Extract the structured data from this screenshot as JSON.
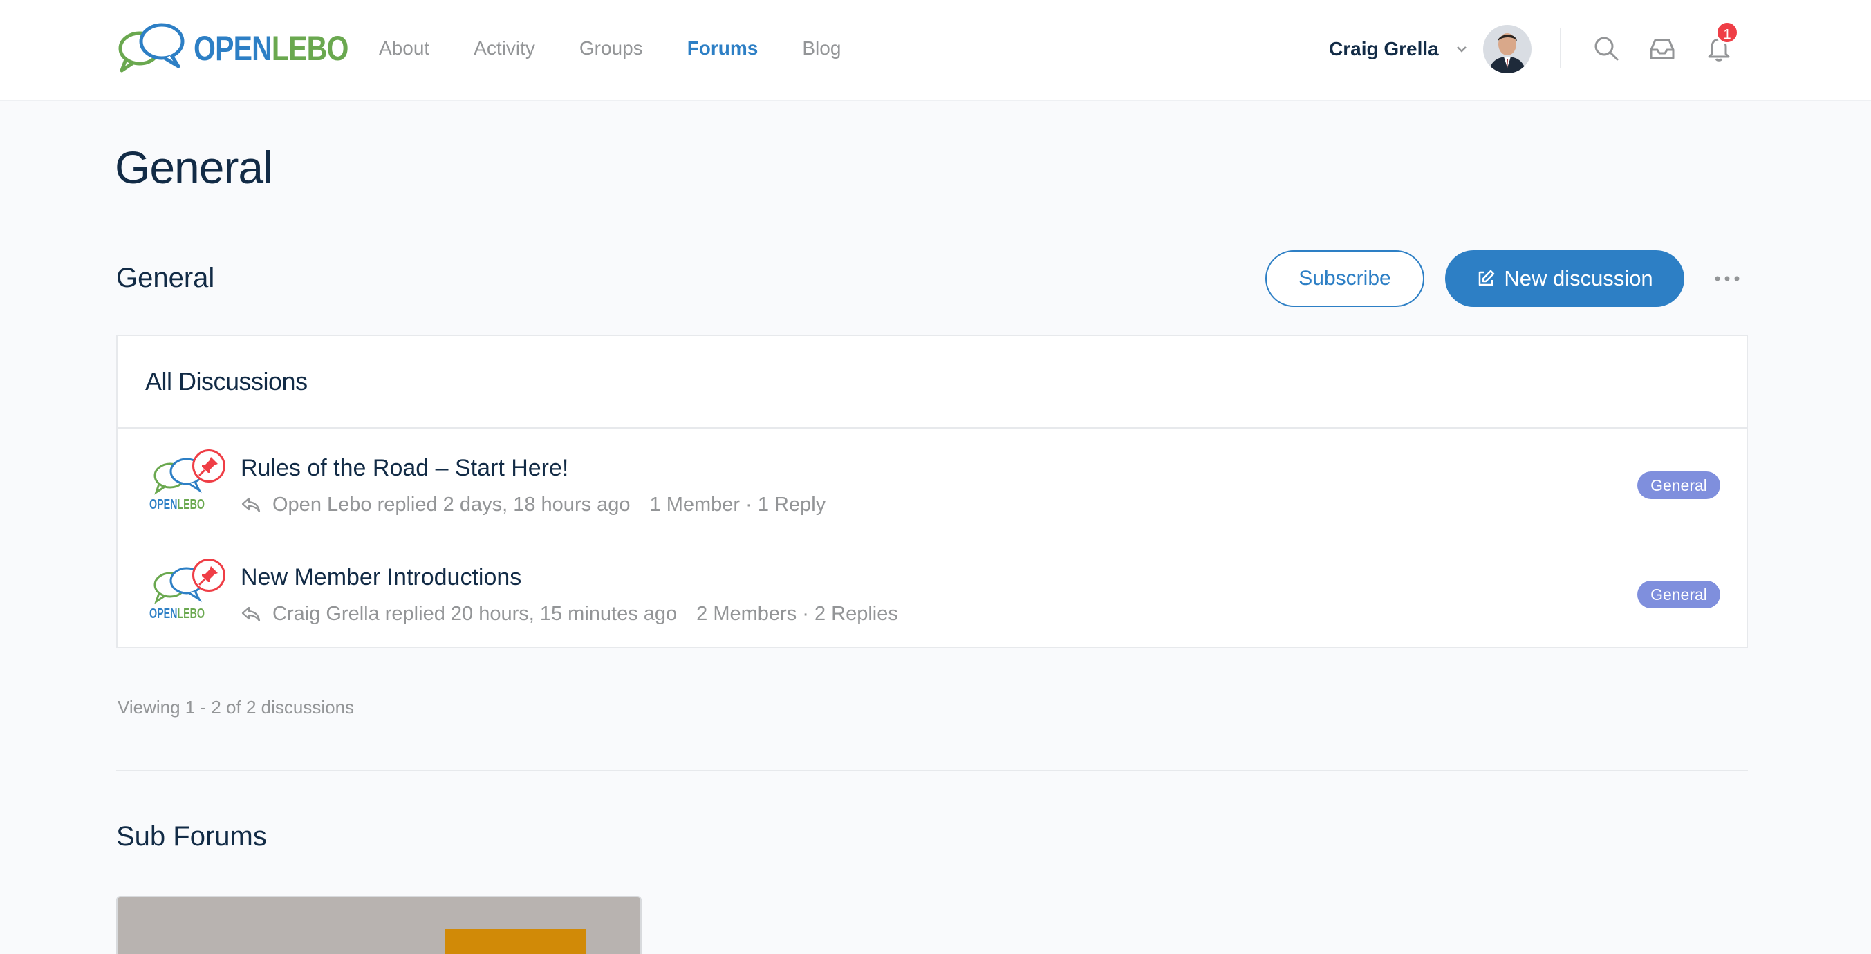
{
  "header": {
    "logo": {
      "open": "OPEN",
      "lebo": "LEBO"
    },
    "nav": [
      "About",
      "Activity",
      "Groups",
      "Forums",
      "Blog"
    ],
    "active_nav": "Forums",
    "user_name": "Craig Grella",
    "notification_count": "1",
    "icons": [
      "search-icon",
      "inbox-icon",
      "bell-icon",
      "chevron-down-icon"
    ]
  },
  "page": {
    "title": "General"
  },
  "forum": {
    "title": "General",
    "subscribe_label": "Subscribe",
    "new_discussion_label": "New discussion"
  },
  "discussions": {
    "heading": "All Discussions",
    "items": [
      {
        "title": "Rules of the Road – Start Here!",
        "replied": "Open Lebo replied 2 days, 18 hours ago",
        "counts": "1 Member · 1 Reply",
        "tag": "General"
      },
      {
        "title": "New Member Introductions",
        "replied": "Craig Grella replied 20 hours, 15 minutes ago",
        "counts": "2 Members · 2 Replies",
        "tag": "General"
      }
    ],
    "avatar_logo": {
      "open": "OPEN",
      "lebo": "LEBO"
    },
    "viewing": "Viewing 1 - 2 of 2 discussions"
  },
  "sub_forums": {
    "title": "Sub Forums"
  },
  "colors": {
    "accent": "#2d7fc5",
    "logo_green": "#6aa84f",
    "tag": "#7f8fdd",
    "pin": "#ef3e46",
    "text": "#122b46",
    "muted": "#939597"
  }
}
